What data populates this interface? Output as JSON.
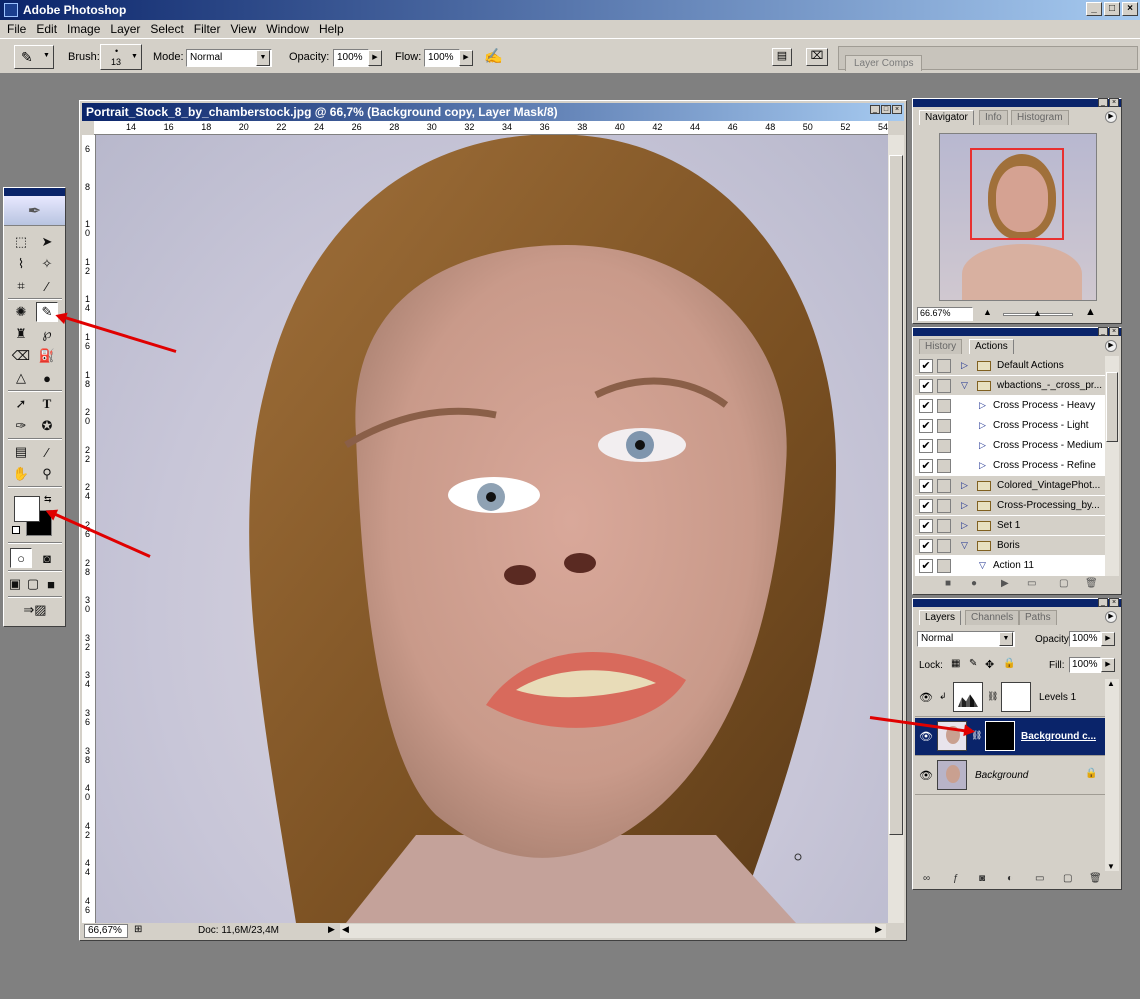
{
  "app": {
    "title": "Adobe Photoshop",
    "window_buttons": [
      "_",
      "□",
      "×"
    ]
  },
  "menu": [
    "File",
    "Edit",
    "Image",
    "Layer",
    "Select",
    "Filter",
    "View",
    "Window",
    "Help"
  ],
  "options_bar": {
    "brush_label": "Brush:",
    "brush_size": "13",
    "mode_label": "Mode:",
    "mode_value": "Normal",
    "opacity_label": "Opacity:",
    "opacity_value": "100%",
    "flow_label": "Flow:",
    "flow_value": "100%",
    "layer_comps_tab": "Layer Comps"
  },
  "document": {
    "title": "Portrait_Stock_8_by_chamberstock.jpg @ 66,7% (Background copy, Layer Mask/8)",
    "ruler_h": [
      "14",
      "16",
      "18",
      "20",
      "22",
      "24",
      "26",
      "28",
      "30",
      "32",
      "34",
      "36",
      "38",
      "40",
      "42",
      "44",
      "46",
      "48",
      "50",
      "52",
      "54"
    ],
    "ruler_v": [
      "6",
      "8",
      "1 0",
      "1 2",
      "1 4",
      "1 6",
      "1 8",
      "2 0",
      "2 2",
      "2 4",
      "2 6",
      "2 8",
      "3 0",
      "3 2",
      "3 4",
      "3 6",
      "3 8",
      "4 0",
      "4 2",
      "4 4",
      "4 6"
    ],
    "zoom": "66,67%",
    "doc_size": "Doc: 11,6M/23,4M"
  },
  "navigator": {
    "tabs": [
      "Navigator",
      "Info",
      "Histogram"
    ],
    "zoom": "66.67%"
  },
  "actions": {
    "tabs": [
      "History",
      "Actions"
    ],
    "items": [
      {
        "label": "Default Actions",
        "type": "set",
        "expanded": false,
        "indent": 0
      },
      {
        "label": "wbactions_-_cross_pr...",
        "type": "set",
        "expanded": true,
        "indent": 0
      },
      {
        "label": "Cross Process - Heavy",
        "type": "action",
        "expanded": false,
        "indent": 1
      },
      {
        "label": "Cross Process - Light",
        "type": "action",
        "expanded": false,
        "indent": 1
      },
      {
        "label": "Cross Process - Medium",
        "type": "action",
        "expanded": false,
        "indent": 1
      },
      {
        "label": "Cross Process - Refine",
        "type": "action",
        "expanded": false,
        "indent": 1
      },
      {
        "label": "Colored_VintagePhot...",
        "type": "set",
        "expanded": false,
        "indent": 0
      },
      {
        "label": "Cross-Processing_by...",
        "type": "set",
        "expanded": false,
        "indent": 0
      },
      {
        "label": "Set 1",
        "type": "set",
        "expanded": false,
        "indent": 0
      },
      {
        "label": "Boris",
        "type": "set",
        "expanded": true,
        "indent": 0
      },
      {
        "label": "Action 11",
        "type": "action",
        "expanded": true,
        "indent": 1
      }
    ]
  },
  "layers": {
    "tabs": [
      "Layers",
      "Channels",
      "Paths"
    ],
    "blend_mode": "Normal",
    "opacity_label": "Opacity:",
    "opacity_value": "100%",
    "lock_label": "Lock:",
    "fill_label": "Fill:",
    "fill_value": "100%",
    "items": [
      {
        "name": "Levels 1",
        "selected": false
      },
      {
        "name": "Background c...",
        "selected": true
      },
      {
        "name": "Background",
        "selected": false
      }
    ]
  },
  "colors": {
    "accent": "#0a246a",
    "arrow": "#e00000"
  }
}
